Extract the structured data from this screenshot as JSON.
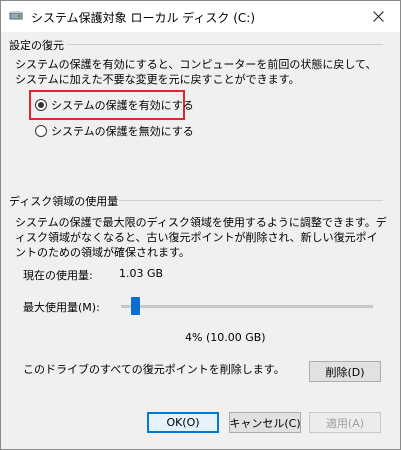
{
  "window": {
    "title": "システム保護対象 ローカル ディスク (C:)",
    "close_icon": "close-icon"
  },
  "restore_settings": {
    "header": "設定の復元",
    "description": "システムの保護を有効にすると、コンピューターを前回の状態に戻して、システムに加えた不要な変更を元に戻すことができます。",
    "options": [
      {
        "label": "システムの保護を有効にする",
        "selected": true
      },
      {
        "label": "システムの保護を無効にする",
        "selected": false
      }
    ]
  },
  "disk_usage": {
    "header": "ディスク領域の使用量",
    "description": "システムの保護で最大限のディスク領域を使用するように調整できます。ディスク領域がなくなると、古い復元ポイントが削除され、新しい復元ポイントのための領域が確保されます。",
    "current_usage_label": "現在の使用量:",
    "current_usage_value": "1.03 GB",
    "max_usage_label": "最大使用量(M):",
    "max_usage_fraction": 0.04,
    "max_usage_display": "4% (10.00 GB)"
  },
  "delete_section": {
    "description": "このドライブのすべての復元ポイントを削除します。",
    "delete_button": "削除(D)"
  },
  "buttons": {
    "ok": "OK(O)",
    "cancel": "キャンセル(C)",
    "apply": "適用(A)"
  },
  "colors": {
    "highlight": "#e0262a",
    "accent": "#0078d7"
  }
}
